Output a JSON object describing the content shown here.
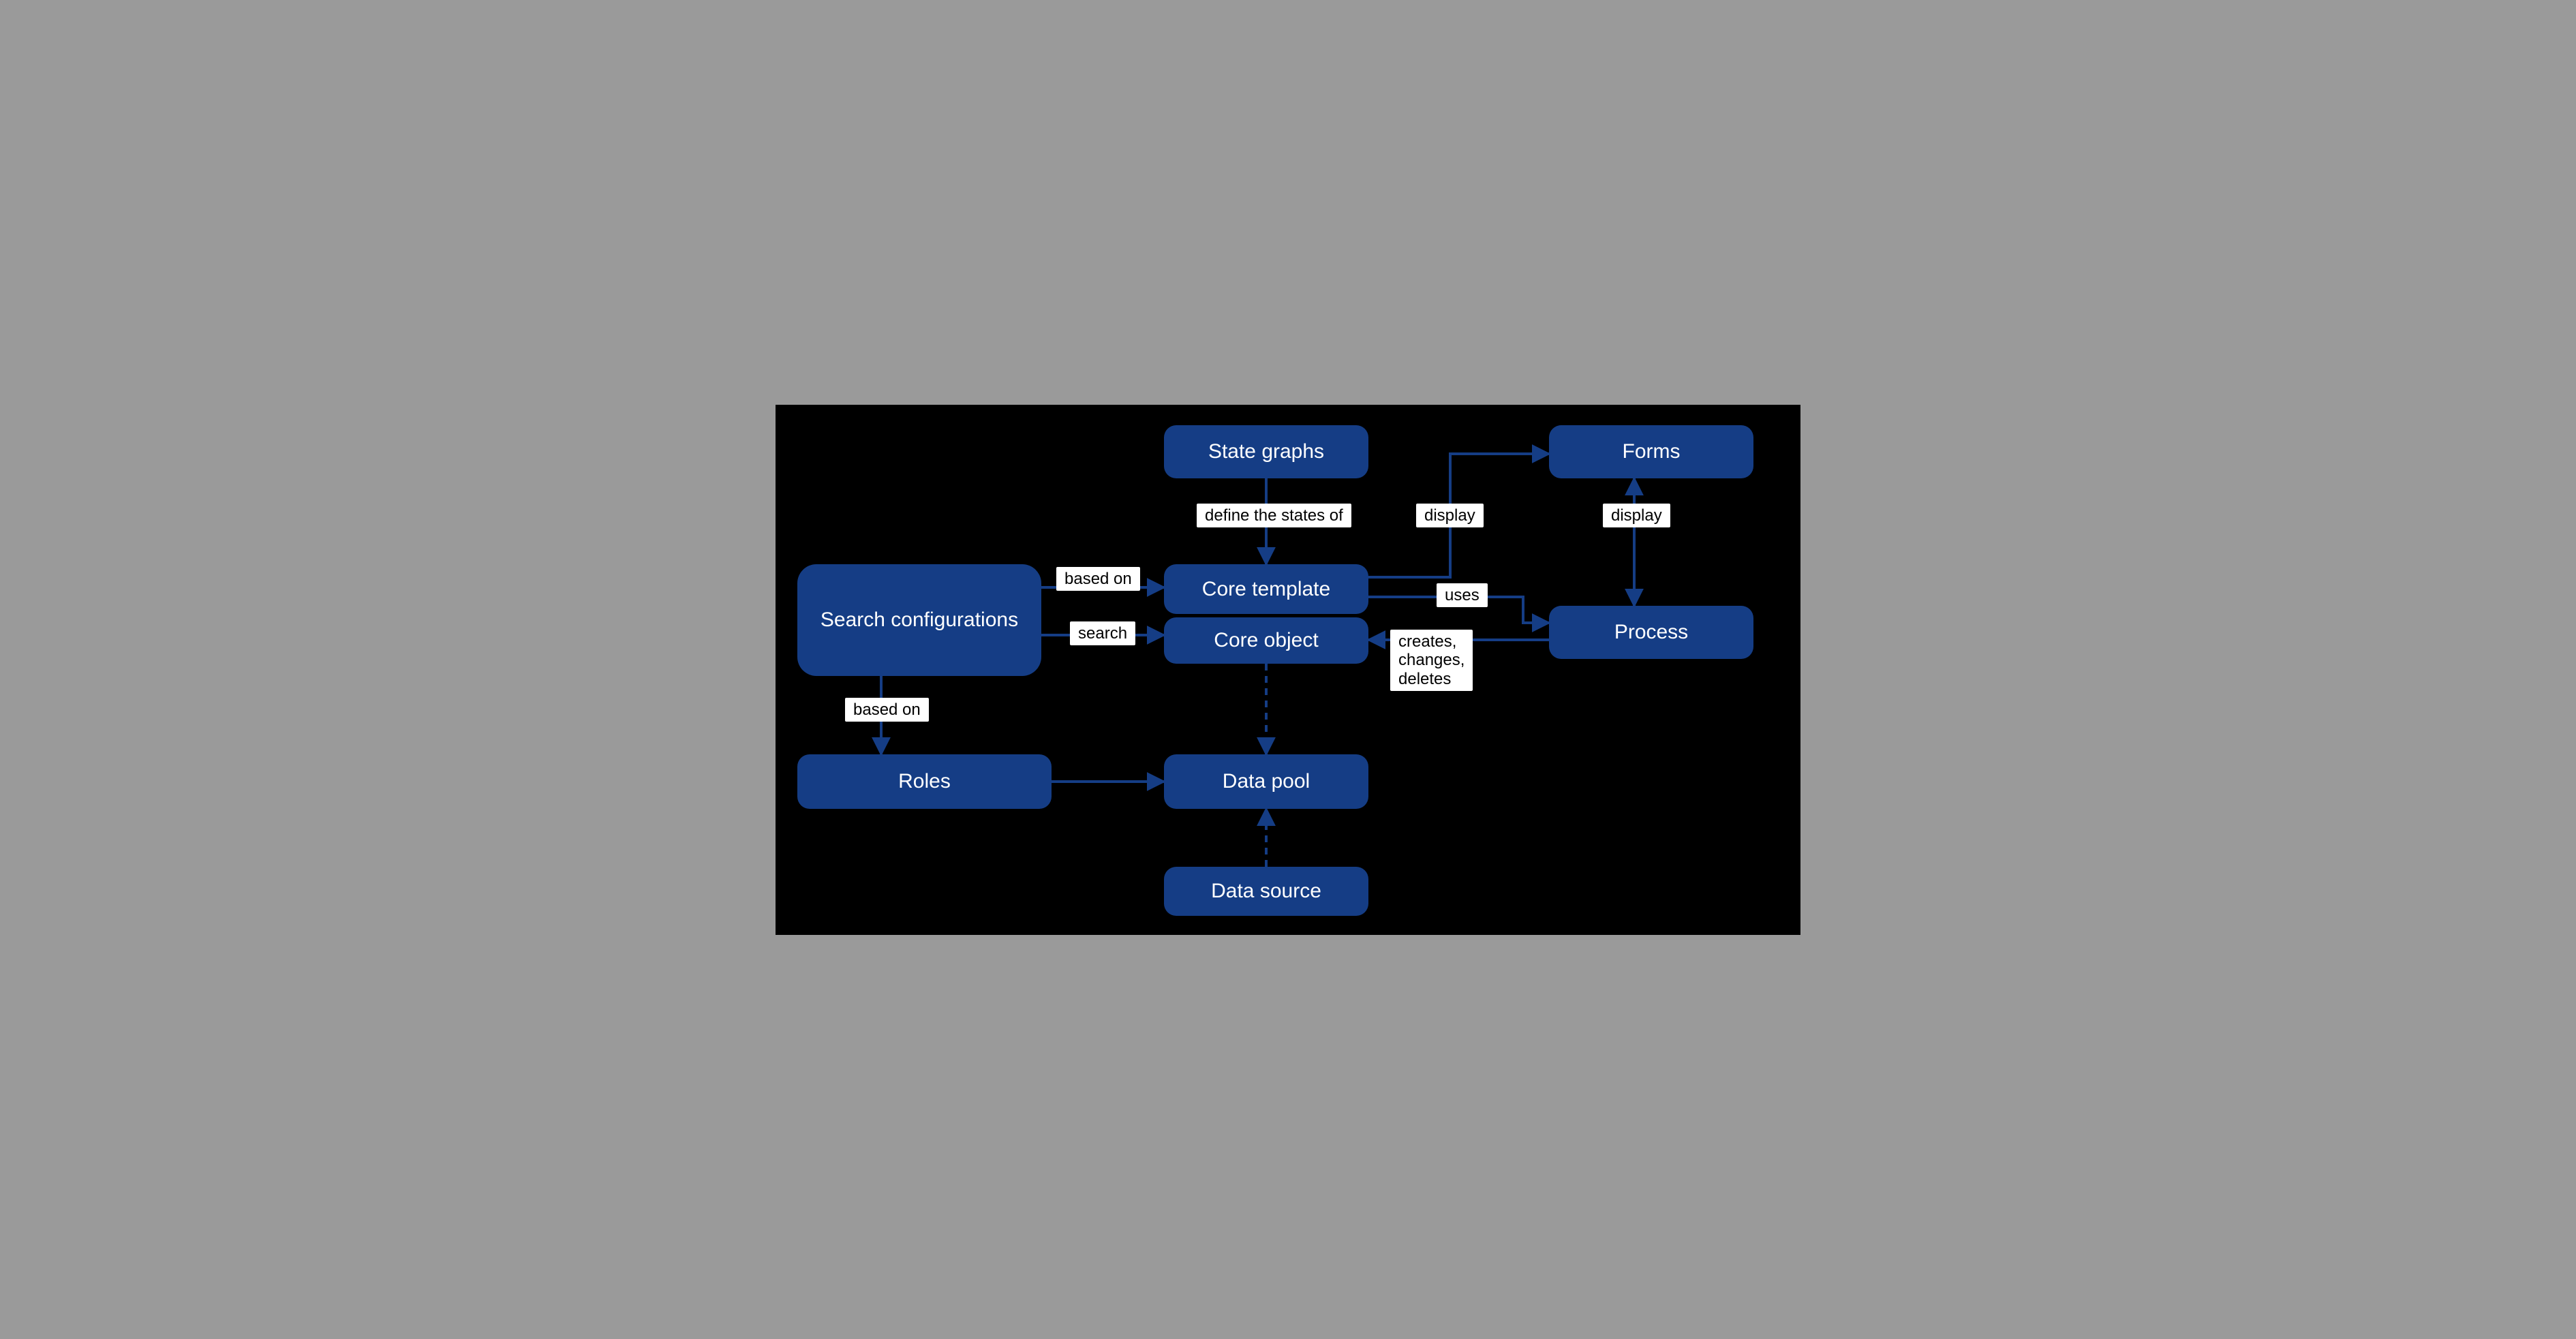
{
  "colors": {
    "node_fill": "#153d85",
    "node_text": "#ffffff",
    "label_fill": "#ffffff",
    "label_text": "#000000",
    "edge": "#153d85",
    "bg": "#000000"
  },
  "nodes": {
    "state_graphs": "State graphs",
    "forms": "Forms",
    "search_configurations": "Search configurations",
    "core_template": "Core template",
    "core_object": "Core object",
    "process": "Process",
    "roles": "Roles",
    "data_pool": "Data pool",
    "data_source": "Data source"
  },
  "edges": {
    "define_states": "define the states of",
    "display_template_forms": "display",
    "display_process_forms": "display",
    "based_on_top": "based on",
    "search": "search",
    "uses": "uses",
    "creates_changes_deletes": "creates,\nchanges,\ndeletes",
    "based_on_roles": "based on"
  }
}
